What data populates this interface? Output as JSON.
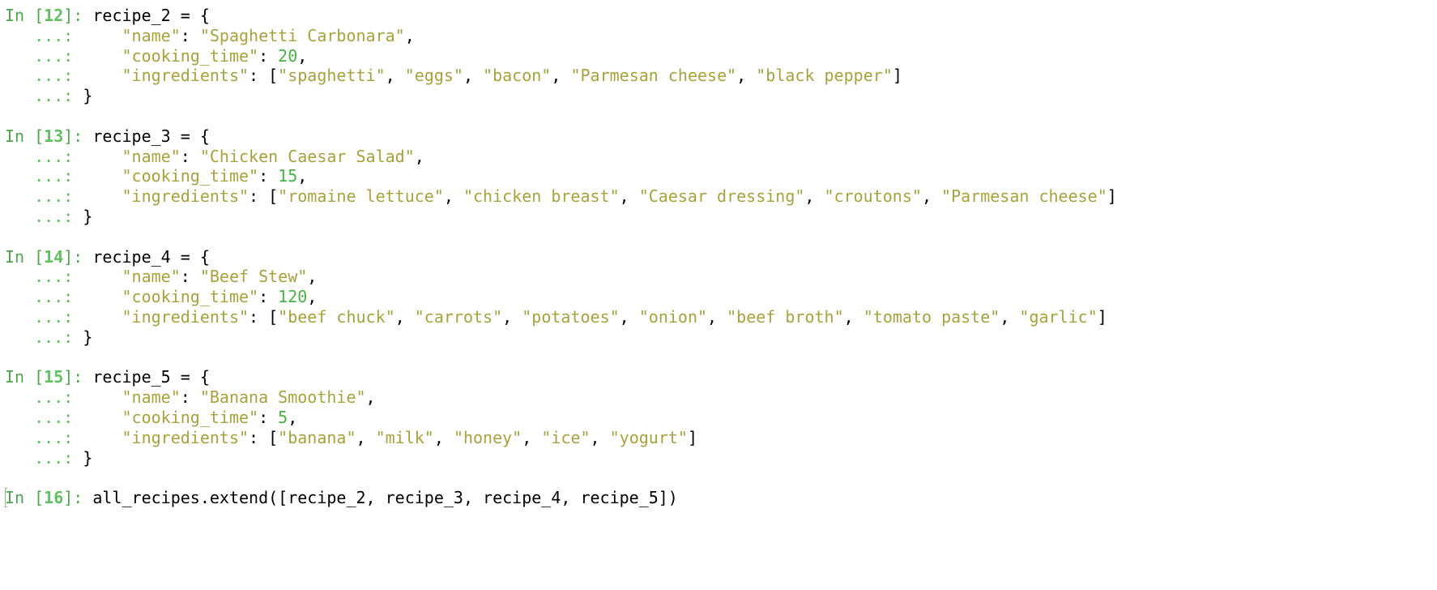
{
  "colors": {
    "background": "#ffffff",
    "prompt": "#4ea64e",
    "string": "#a7a33a",
    "number": "#42b542",
    "text": "#000000"
  },
  "cells": [
    {
      "prompt_in": "In [",
      "prompt_num": "12",
      "prompt_close": "]: ",
      "line1": "recipe_2 = {",
      "cont": "   ...: ",
      "name_key": "\"name\"",
      "name_val": "\"Spaghetti Carbonara\"",
      "time_key": "\"cooking_time\"",
      "time_val": "20",
      "ing_key": "\"ingredients\"",
      "ingredients": [
        "\"spaghetti\"",
        "\"eggs\"",
        "\"bacon\"",
        "\"Parmesan cheese\"",
        "\"black pepper\""
      ],
      "close": "}"
    },
    {
      "prompt_in": "In [",
      "prompt_num": "13",
      "prompt_close": "]: ",
      "line1": "recipe_3 = {",
      "cont": "   ...: ",
      "name_key": "\"name\"",
      "name_val": "\"Chicken Caesar Salad\"",
      "time_key": "\"cooking_time\"",
      "time_val": "15",
      "ing_key": "\"ingredients\"",
      "ingredients": [
        "\"romaine lettuce\"",
        "\"chicken breast\"",
        "\"Caesar dressing\"",
        "\"croutons\"",
        "\"Parmesan cheese\""
      ],
      "close": "}"
    },
    {
      "prompt_in": "In [",
      "prompt_num": "14",
      "prompt_close": "]: ",
      "line1": "recipe_4 = {",
      "cont": "   ...: ",
      "name_key": "\"name\"",
      "name_val": "\"Beef Stew\"",
      "time_key": "\"cooking_time\"",
      "time_val": "120",
      "ing_key": "\"ingredients\"",
      "ingredients": [
        "\"beef chuck\"",
        "\"carrots\"",
        "\"potatoes\"",
        "\"onion\"",
        "\"beef broth\"",
        "\"tomato paste\"",
        "\"garlic\""
      ],
      "close": "}"
    },
    {
      "prompt_in": "In [",
      "prompt_num": "15",
      "prompt_close": "]: ",
      "line1": "recipe_5 = {",
      "cont": "   ...: ",
      "name_key": "\"name\"",
      "name_val": "\"Banana Smoothie\"",
      "time_key": "\"cooking_time\"",
      "time_val": "5",
      "ing_key": "\"ingredients\"",
      "ingredients": [
        "\"banana\"",
        "\"milk\"",
        "\"honey\"",
        "\"ice\"",
        "\"yogurt\""
      ],
      "close": "}"
    }
  ],
  "last_cell": {
    "prompt_in": "In [",
    "prompt_num": "16",
    "prompt_close": "]: ",
    "code": "all_recipes.extend([recipe_2, recipe_3, recipe_4, recipe_5])"
  }
}
